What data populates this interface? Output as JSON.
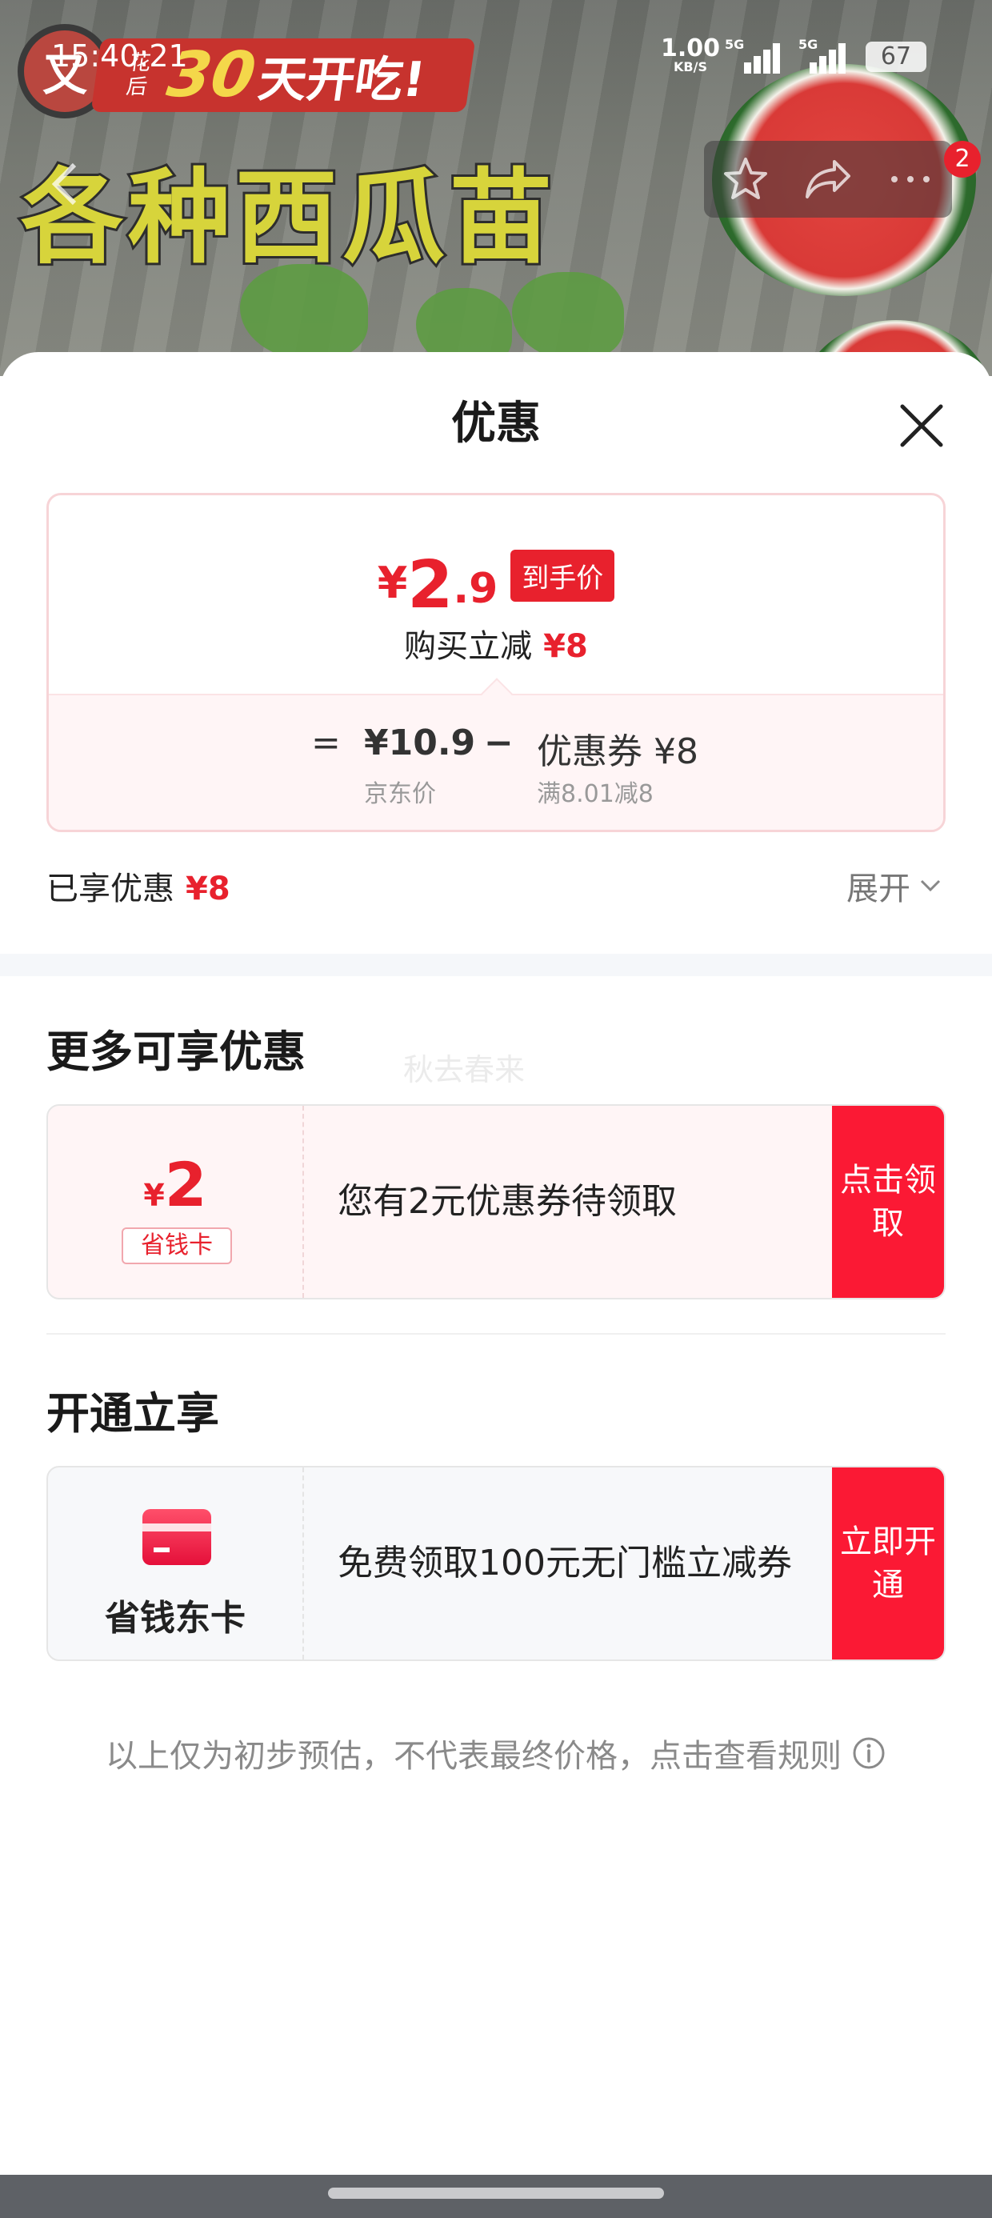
{
  "status_bar": {
    "time": "15:40:21",
    "net_speed_value": "1.00",
    "net_speed_unit": "KB/S",
    "signal_1_tag": "5G",
    "signal_2_tag": "5G",
    "battery": "67"
  },
  "banner": {
    "badge_text": "又",
    "promo_small": "花后",
    "promo_big": "30",
    "promo_rest": "天开吃!",
    "headline": "各种西瓜苗"
  },
  "nav": {
    "back_icon": "chevron-left-icon",
    "favorite_icon": "star-icon",
    "share_icon": "share-icon",
    "more_icon": "more-icon",
    "cart_count": "2"
  },
  "sheet": {
    "title": "优惠",
    "close_icon": "close-icon",
    "price_card": {
      "currency": "¥",
      "price_integer": "2",
      "price_decimal": ".9",
      "price_tag": "到手价",
      "saving_label": "购买立减",
      "saving_amount": "¥8",
      "equals": "=",
      "jd_price": "¥10.9",
      "jd_price_label": "京东价",
      "minus": "−",
      "coupon": "优惠券 ¥8",
      "coupon_rule": "满8.01减8"
    },
    "enjoyed": {
      "label": "已享优惠",
      "amount": "¥8",
      "expand_label": "展开"
    },
    "more_offers": {
      "title": "更多可享优惠",
      "watermark": "秋去春来",
      "coupon": {
        "currency": "¥",
        "value": "2",
        "label": "省钱卡",
        "description": "您有2元优惠券待领取",
        "action": "点击领取"
      }
    },
    "activate": {
      "title": "开通立享",
      "card": {
        "name": "省钱东卡",
        "description": "免费领取100元无门槛立减券",
        "action": "立即开通"
      }
    },
    "disclaimer": "以上仅为初步预估，不代表最终价格，点击查看规则",
    "info_icon": "info-icon"
  },
  "colors": {
    "accent": "#e8212d",
    "action_button": "#fb1934",
    "price_bg": "#fff5f6",
    "muted_text": "#8a8a8a"
  }
}
